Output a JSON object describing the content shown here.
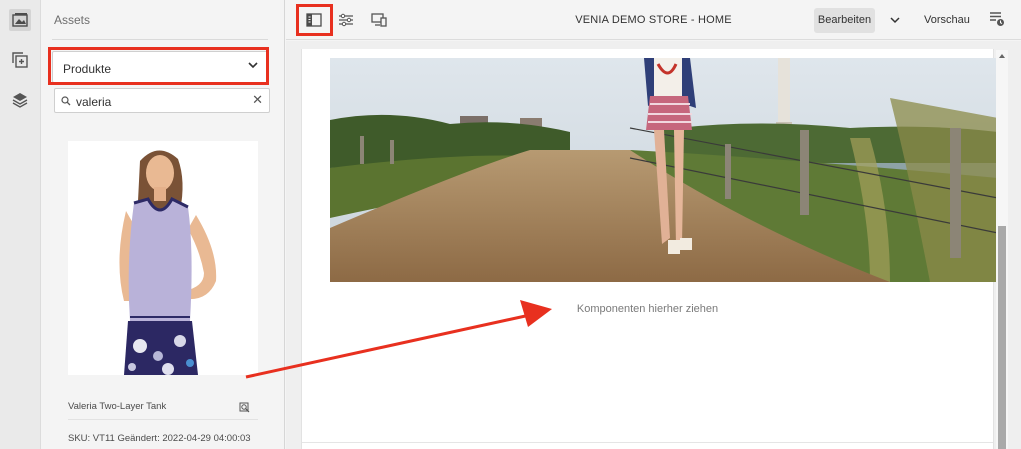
{
  "panel": {
    "title": "Assets",
    "dropdown_value": "Produkte",
    "search_value": "valeria",
    "clear_glyph": "✕"
  },
  "asset_card": {
    "name": "Valeria Two-Layer Tank",
    "meta": "SKU: VT11  Geändert: 2022-04-29 04:00:03"
  },
  "toolbar": {
    "page_title": "VENIA DEMO STORE - HOME",
    "edit_label": "Bearbeiten",
    "preview_label": "Vorschau"
  },
  "canvas": {
    "drop_text": "Komponenten hierher ziehen"
  },
  "colors": {
    "annotation_red": "#e8301f"
  }
}
